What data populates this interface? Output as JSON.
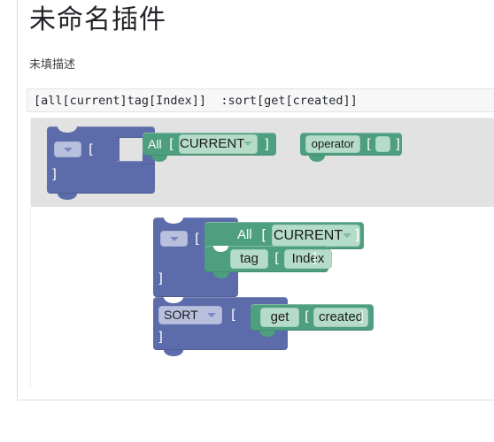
{
  "page": {
    "title": "未命名插件",
    "description": "未填描述",
    "code_expression": "[all[current]tag[Index]]  :sort[get[created]]"
  },
  "colors": {
    "statement_block": "#5c6ba9",
    "value_block": "#4e9e80",
    "value_field": "#b5dcc8",
    "statement_field": "#b9c0dd",
    "toolbox_bg": "#e2e2e2",
    "workspace_bg": "#ffffff",
    "code_bg": "#f7f7f8"
  },
  "toolbox": {
    "label": "blockly-toolbox",
    "blocks": [
      {
        "id": "toolbox-statement-block",
        "kind": "statement",
        "dropdown_value": "",
        "open_bracket": "[",
        "close_bracket": "]"
      },
      {
        "id": "toolbox-all-block",
        "kind": "value",
        "label": "All",
        "open_bracket": "[",
        "field_value": "CURRENT",
        "field_has_dropdown": true,
        "close_bracket": "]"
      },
      {
        "id": "toolbox-operator-block",
        "kind": "value",
        "label": "",
        "field_value": "operator",
        "open_bracket": "[",
        "slot_value": "",
        "close_bracket": "]"
      }
    ]
  },
  "workspace": {
    "label": "blockly-workspace",
    "blocks": [
      {
        "id": "ws-filter-block",
        "kind": "statement",
        "dropdown_value": "",
        "open_bracket": "[",
        "close_bracket": "]",
        "inputs": [
          {
            "id": "ws-all-current-block",
            "kind": "value",
            "label": "All",
            "open_bracket": "[",
            "field_value": "CURRENT",
            "field_has_dropdown": true,
            "close_bracket": "]"
          },
          {
            "id": "ws-tag-index-block",
            "kind": "value",
            "field_value": "tag",
            "open_bracket": "[",
            "arg_value": "Index",
            "close_bracket": "]"
          }
        ]
      },
      {
        "id": "ws-sort-block",
        "kind": "statement",
        "dropdown_value": "SORT",
        "dropdown_has_arrow": true,
        "open_bracket": "[",
        "close_bracket": "]",
        "inputs": [
          {
            "id": "ws-get-created-block",
            "kind": "value",
            "field_value": "get",
            "open_bracket": "[",
            "arg_value": "created",
            "close_bracket": "]"
          }
        ]
      }
    ]
  }
}
